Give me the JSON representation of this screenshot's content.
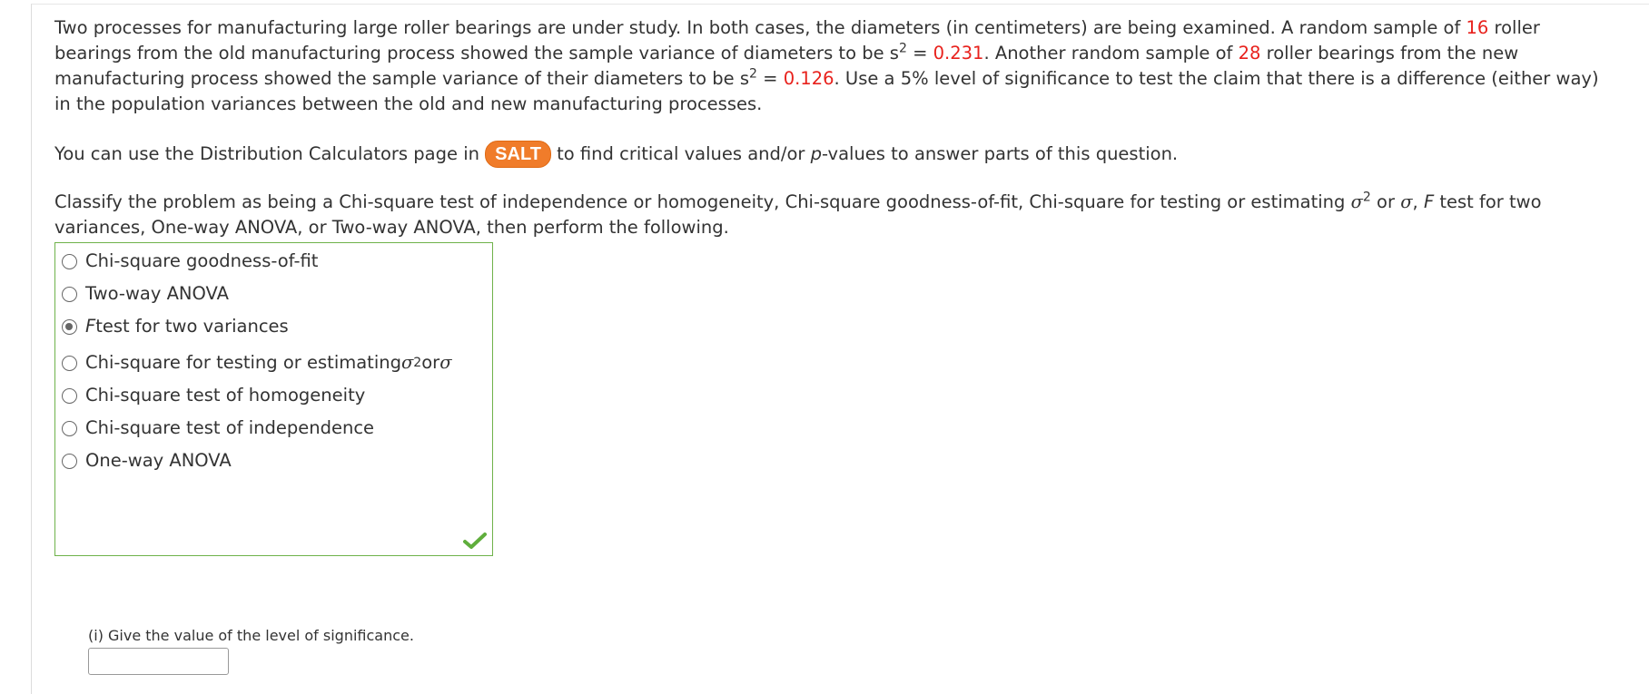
{
  "problem": {
    "p1": "Two processes for manufacturing large roller bearings are under study. In both cases, the diameters (in centimeters) are being examined. A random sample of ",
    "n1": "16",
    "p2": " roller bearings from the old manufacturing process showed the sample variance of diameters to be s",
    "exp": "2",
    "eq": " = ",
    "s1": "0.231",
    "p3": ". Another random sample of ",
    "n2": "28",
    "p4": " roller bearings from the new manufacturing process showed the sample variance of their diameters to be s",
    "s2": "0.126",
    "p5": ". Use a 5% level of significance to test the claim that there is a difference (either way) in the population variances between the old and new manufacturing processes."
  },
  "salt_line": {
    "before": "You can use the Distribution Calculators page in ",
    "salt_label": "SALT",
    "after_1": " to find critical values and/or ",
    "p_italic": "p",
    "after_2": "-values to answer parts of this question."
  },
  "classify": {
    "part1": "Classify the problem as being a Chi-square test of independence or homogeneity, Chi-square goodness-of-fit, Chi-square for testing or estimating ",
    "sigma": "σ",
    "exp": "2",
    "or": " or ",
    "comma": ", ",
    "f_italic": "F",
    "part2": " test for two variances, One-way ANOVA, or Two-way ANOVA, then perform the following."
  },
  "choices": [
    {
      "label": "Chi-square goodness-of-fit",
      "checked": false
    },
    {
      "label": "Two-way ANOVA",
      "checked": false
    },
    {
      "label_italic": "F",
      "label": " test for two variances",
      "checked": true
    },
    {
      "label": "Chi-square for testing or estimating ",
      "sigma": "σ",
      "exp": "2",
      "or": " or ",
      "checked": false
    },
    {
      "label": "Chi-square test of homogeneity",
      "checked": false
    },
    {
      "label": "Chi-square test of independence",
      "checked": false
    },
    {
      "label": "One-way ANOVA",
      "checked": false
    }
  ],
  "feedback_icon": "checkmark-icon",
  "colors": {
    "accent_red": "#e8211c",
    "salt_orange": "#f07c2a",
    "correct_green": "#6fb24a"
  },
  "part_i": {
    "prompt": "(i) Give the value of the level of significance.",
    "value": ""
  }
}
